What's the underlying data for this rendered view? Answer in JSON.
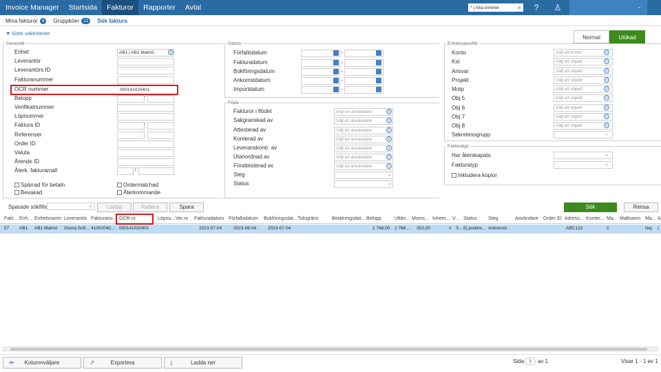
{
  "topnav": {
    "brand": "Invoice Manager",
    "items": [
      "Startsida",
      "Fakturor",
      "Rapporter",
      "Avtal"
    ],
    "unit_select": "* | Alla enheter"
  },
  "subnav": {
    "mina": "Mina fakturor",
    "mina_count": "9",
    "grupp": "Gruppköer",
    "grupp_count": "12",
    "sok": "Sök faktura"
  },
  "criteria_toggle": "▼ Göm sökkriterier",
  "modes": {
    "normal": "Normal",
    "utokad": "Utökad"
  },
  "generellt": {
    "legend": "Generellt",
    "labels": [
      "Enhet",
      "Leverantör",
      "Leverantörs ID",
      "Fakturanummer",
      "OCR nummer",
      "Belopp",
      "Verifikatnummer",
      "Löpnummer",
      "Faktura ID",
      "Referenser",
      "Order ID",
      "Valuta",
      "Ärende ID",
      "Återk. fakturamall"
    ],
    "enhet_value": "AB1 | AB1 Malmö",
    "ocr_value": "000141020401",
    "belopp_sep": "-",
    "faktura_sep": "-",
    "aterk_sep": "/",
    "checks": [
      "Spärrad för betaln.",
      "Bevakad",
      "Ordermatchad",
      "Återkommande"
    ]
  },
  "datum": {
    "legend": "Datum",
    "labels": [
      "Förfallodatum",
      "Fakturadatum",
      "Bokföringsdatum",
      "Ankomstdatum",
      "Importdatum"
    ],
    "sep": "-"
  },
  "flode": {
    "legend": "Flöde",
    "labels": [
      "Fakturor i flödet",
      "Sakgranskad av",
      "Attesterad av",
      "Konterad av",
      "Leveranskontr. av",
      "Utanordnad av",
      "Förattesterad av",
      "Steg",
      "Status"
    ],
    "placeholder": "Välj en användare"
  },
  "enhetsspecifikt": {
    "legend": "Enhetsspecifikt",
    "labels": [
      "Konto",
      "Kst",
      "Ansvar",
      "Projekt",
      "Motp",
      "Obj 5",
      "Obj 6",
      "Obj 7",
      "Obj 8",
      "Sekretessgrupp"
    ],
    "konto_placeholder": "Välj ett konto",
    "obj_placeholder": "Välj ett objekt"
  },
  "fakturatyp": {
    "legend": "Fakturatyp",
    "labels": [
      "Har återskapats",
      "Fakturatyp"
    ],
    "check": "Inkludera kopior"
  },
  "filters": {
    "saved": "Sparade sökfilter",
    "ladda": "Ladda",
    "radera": "Radera",
    "spara": "Spara",
    "sok": "Sök",
    "rensa": "Rensa"
  },
  "grid": {
    "headers": [
      "Fakt...",
      "Enh...",
      "Enhetsnamn",
      "Leverantör",
      "Fakturanu...",
      "OCR-nr",
      "Löpnu...",
      "Ver.nr",
      "Fakturadatum",
      "Förfallodatum",
      "Bokföringsdat...",
      "Tidsgräns",
      "Betalningsdat...",
      "Belopp",
      "Utlän...",
      "Moms...",
      "Inhem...",
      "V...",
      "Status",
      "Steg",
      "Användare",
      "Order ID",
      "Adress...",
      "Konter...",
      "Ma...",
      "Mallnamn",
      "Ma...",
      "A"
    ],
    "row": [
      "57",
      "AB1",
      "AB1 Malmö",
      "Visma Soft...",
      "41002040...",
      "000141020401",
      "",
      "",
      "2023-07-04",
      "2023-08-04",
      "2023-07-04",
      "",
      "",
      "1 768,00",
      "1 768...",
      "353,00",
      "0",
      "S...",
      "Ej prelimi...",
      "Ankomstr...",
      "",
      "",
      "ABC123",
      "0",
      "",
      "",
      "Nej",
      "("
    ]
  },
  "footer": {
    "kolumn": "Kolumnväljare",
    "exportera": "Exportera",
    "ladda_ner": "Ladda ner",
    "sida": "Sida",
    "sida_val": "1",
    "av": "av 1",
    "visar": "Visar 1 - 1 av 1"
  }
}
